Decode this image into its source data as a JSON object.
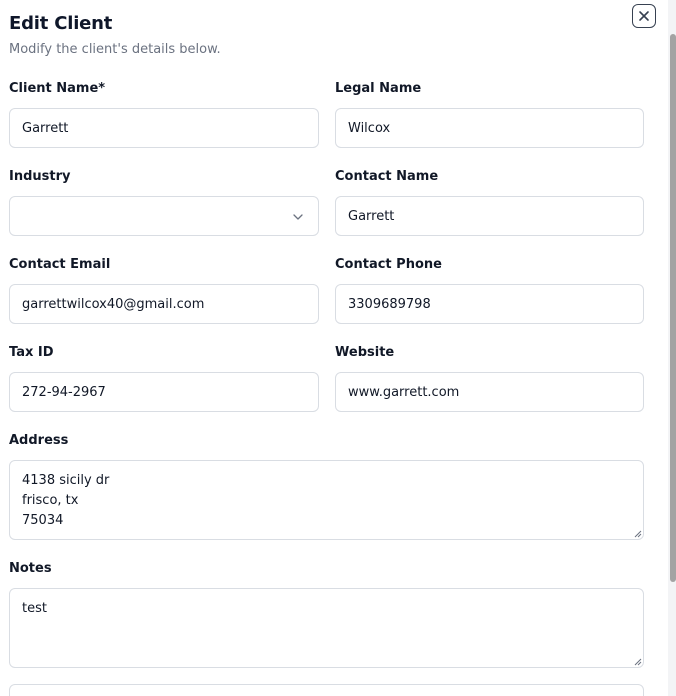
{
  "dialog": {
    "title": "Edit Client",
    "subtitle": "Modify the client's details below."
  },
  "form": {
    "client_name": {
      "label": "Client Name*",
      "value": "Garrett"
    },
    "legal_name": {
      "label": "Legal Name",
      "value": "Wilcox"
    },
    "industry": {
      "label": "Industry",
      "value": ""
    },
    "contact_name": {
      "label": "Contact Name",
      "value": "Garrett"
    },
    "contact_email": {
      "label": "Contact Email",
      "value": "garrettwilcox40@gmail.com"
    },
    "contact_phone": {
      "label": "Contact Phone",
      "value": "3309689798"
    },
    "tax_id": {
      "label": "Tax ID",
      "value": "272-94-2967"
    },
    "website": {
      "label": "Website",
      "value": "www.garrett.com"
    },
    "address": {
      "label": "Address",
      "value": "4138 sicily dr\nfrisco, tx\n75034"
    },
    "notes": {
      "label": "Notes",
      "value": "test"
    }
  },
  "icons": {
    "close": "close-icon",
    "chevron": "chevron-down-icon",
    "resize": "resize-grip-icon"
  }
}
